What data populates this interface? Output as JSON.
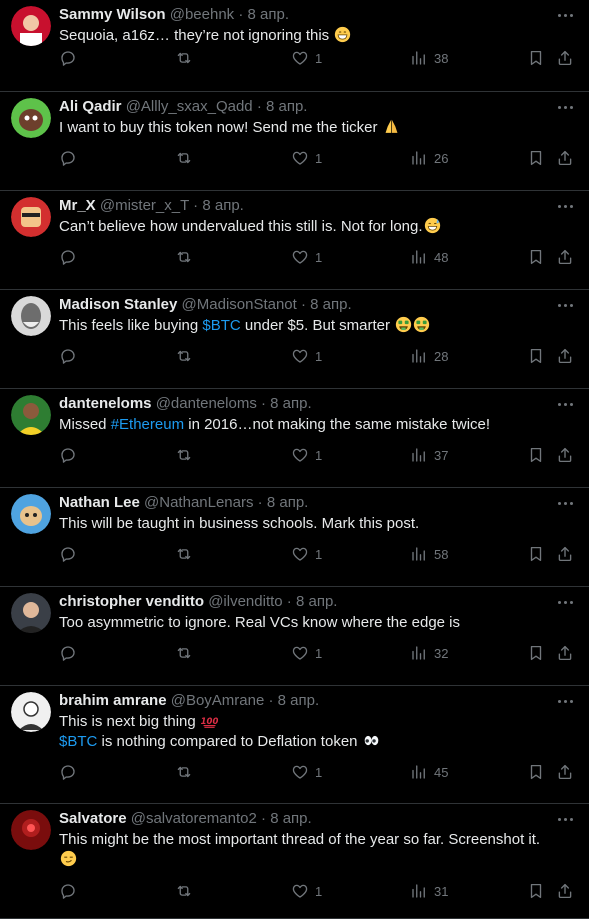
{
  "tweets": [
    {
      "name": "Sammy Wilson",
      "handle": "@beehnk",
      "separator": "·",
      "date": "8 апр.",
      "lines": [
        [
          {
            "t": "Sequoia, a16z… they’re not ignoring this "
          }
        ]
      ],
      "emoji": [
        "grin"
      ],
      "replies": "",
      "retweets": "",
      "likes": "1",
      "views": "38",
      "avatar_color": "#c8102e"
    },
    {
      "name": "Ali Qadir",
      "handle": "@Allly_sxax_Qadd",
      "separator": "·",
      "date": "8 апр.",
      "lines": [
        [
          {
            "t": "I want to buy this token now! Send me the ticker "
          }
        ]
      ],
      "emoji": [
        "pray"
      ],
      "replies": "",
      "retweets": "",
      "likes": "1",
      "views": "26",
      "avatar_color": "#5ec24a"
    },
    {
      "name": "Mr_X",
      "handle": "@mister_x_T",
      "separator": "·",
      "date": "8 апр.",
      "lines": [
        [
          {
            "t": "Can’t believe how undervalued this still is. Not for long."
          }
        ]
      ],
      "emoji": [
        "sweat"
      ],
      "replies": "",
      "retweets": "",
      "likes": "1",
      "views": "48",
      "avatar_color": "#d32f2f"
    },
    {
      "name": "Madison Stanley",
      "handle": "@MadisonStanot",
      "separator": "·",
      "date": "8 апр.",
      "lines": [
        [
          {
            "t": "This feels like buying "
          },
          {
            "t": "$BTC",
            "link": true
          },
          {
            "t": " under $5. But smarter "
          }
        ]
      ],
      "emoji": [
        "money",
        "money"
      ],
      "replies": "",
      "retweets": "",
      "likes": "1",
      "views": "28",
      "avatar_color": "#6d6d6d"
    },
    {
      "name": "danteneloms",
      "handle": "@danteneloms",
      "separator": "·",
      "date": "8 апр.",
      "lines": [
        [
          {
            "t": "Missed "
          },
          {
            "t": "#Ethereum",
            "link": true
          },
          {
            "t": " in 2016…not making the same mistake twice!"
          }
        ]
      ],
      "emoji": [],
      "replies": "",
      "retweets": "",
      "likes": "1",
      "views": "37",
      "avatar_color": "#2e7d32"
    },
    {
      "name": "Nathan Lee",
      "handle": "@NathanLenars",
      "separator": "·",
      "date": "8 апр.",
      "lines": [
        [
          {
            "t": "This will be taught in business schools. Mark this post."
          }
        ]
      ],
      "emoji": [],
      "replies": "",
      "retweets": "",
      "likes": "1",
      "views": "58",
      "avatar_color": "#4fa3e0"
    },
    {
      "name": "christopher venditto",
      "handle": "@ilvenditto",
      "separator": "·",
      "date": "8 апр.",
      "lines": [
        [
          {
            "t": "Too asymmetric to ignore. Real VCs know where the edge is"
          }
        ]
      ],
      "emoji": [],
      "replies": "",
      "retweets": "",
      "likes": "1",
      "views": "32",
      "avatar_color": "#3a3f47"
    },
    {
      "name": "brahim amrane",
      "handle": "@BoyAmrane",
      "separator": "·",
      "date": "8 апр.",
      "lines": [
        [
          {
            "t": "This is next big thing "
          }
        ],
        [
          {
            "t": "$BTC",
            "link": true
          },
          {
            "t": " is nothing compared to Deflation token "
          }
        ]
      ],
      "emoji": [
        "hundred",
        "eyes"
      ],
      "replies": "",
      "retweets": "",
      "likes": "1",
      "views": "45",
      "avatar_color": "#f0f0f0"
    },
    {
      "name": "Salvatore",
      "handle": "@salvatoremanto2",
      "separator": "·",
      "date": "8 апр.",
      "lines": [
        [
          {
            "t": "This might be the most important thread of the year so far. Screenshot it."
          }
        ],
        [
          {
            "t": ""
          }
        ]
      ],
      "emoji": [
        "smirk"
      ],
      "replies": "",
      "retweets": "",
      "likes": "1",
      "views": "31",
      "avatar_color": "#7a0d0d"
    }
  ],
  "colors": {
    "background": "#000000",
    "text": "#e7e9ea",
    "muted": "#71767b",
    "link": "#1d9bf0",
    "divider": "#2f3336"
  }
}
